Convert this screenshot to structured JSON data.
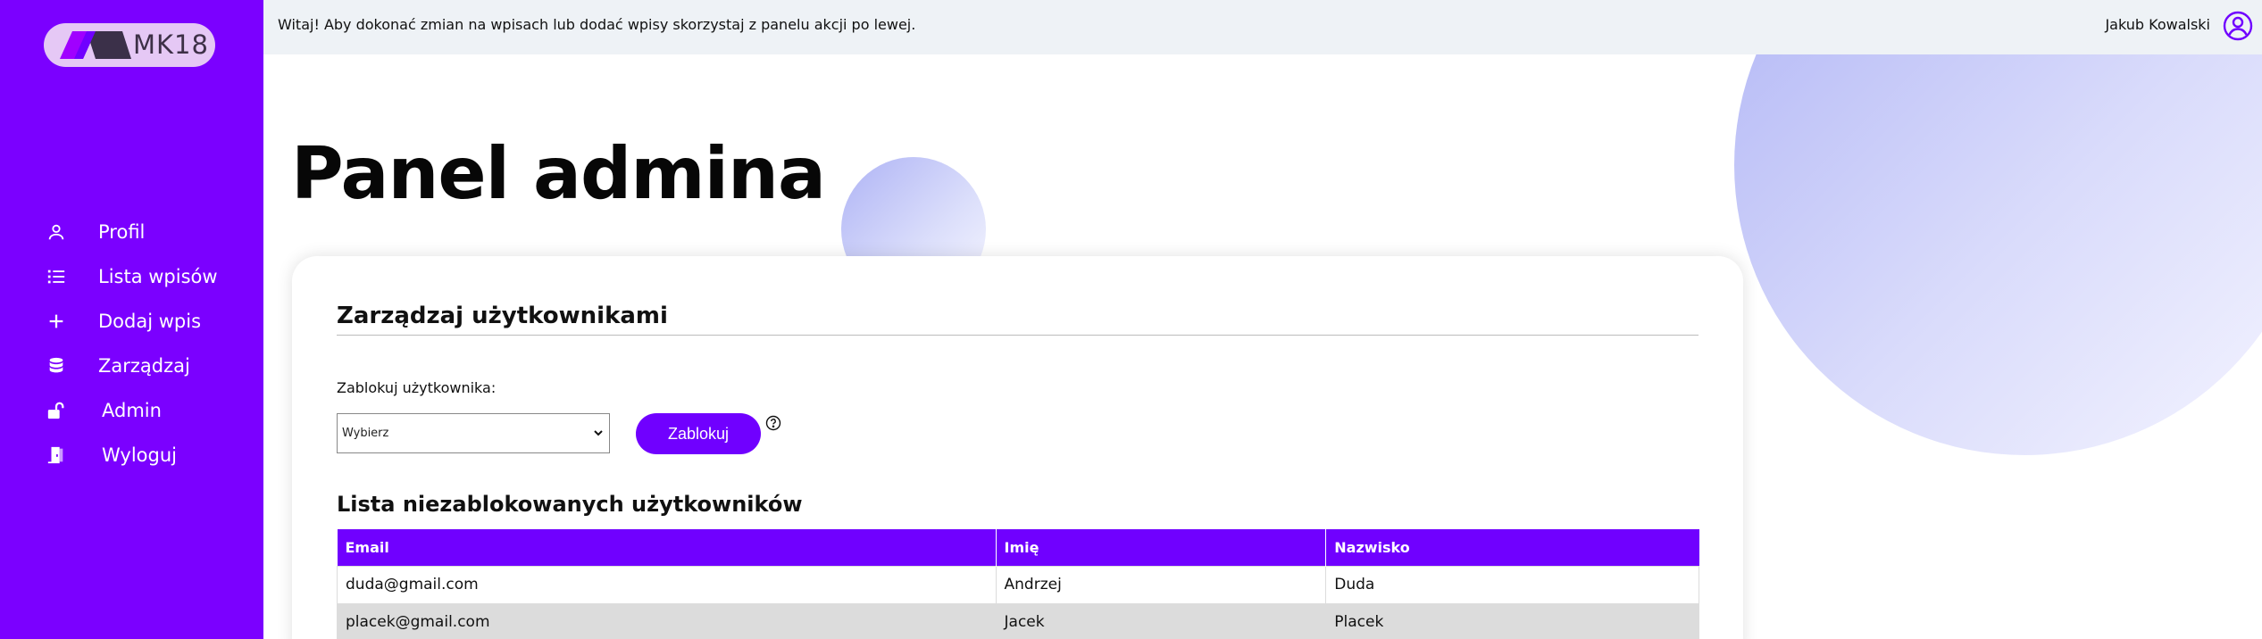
{
  "app": {
    "logo_text": "MK18"
  },
  "sidebar": {
    "items": [
      {
        "label": "Profil",
        "icon": "user-icon"
      },
      {
        "label": "Lista wpisów",
        "icon": "list-icon"
      },
      {
        "label": "Dodaj wpis",
        "icon": "plus-icon"
      },
      {
        "label": "Zarządzaj",
        "icon": "database-icon"
      },
      {
        "label": "Admin",
        "icon": "unlock-icon"
      },
      {
        "label": "Wyloguj",
        "icon": "door-exit-icon"
      }
    ]
  },
  "topbar": {
    "welcome": "Witaj! Aby dokonać zmian na wpisach lub dodać wpisy skorzystaj z panelu akcji po lewej.",
    "user_name": "Jakub Kowalski"
  },
  "page": {
    "title": "Panel admina"
  },
  "card": {
    "title": "Zarządzaj użytkownikami",
    "block_label": "Zablokuj użytkownika:",
    "select_value": "Wybierz",
    "block_button": "Zablokuj",
    "list_title": "Lista niezablokowanych użytkowników",
    "table": {
      "headers": [
        "Email",
        "Imię",
        "Nazwisko"
      ],
      "rows": [
        [
          "duda@gmail.com",
          "Andrzej",
          "Duda"
        ],
        [
          "placek@gmail.com",
          "Jacek",
          "Placek"
        ]
      ]
    }
  },
  "colors": {
    "primary": "#7000ff",
    "sidebar": "#7b00ff",
    "topbar": "#eef2f6"
  }
}
